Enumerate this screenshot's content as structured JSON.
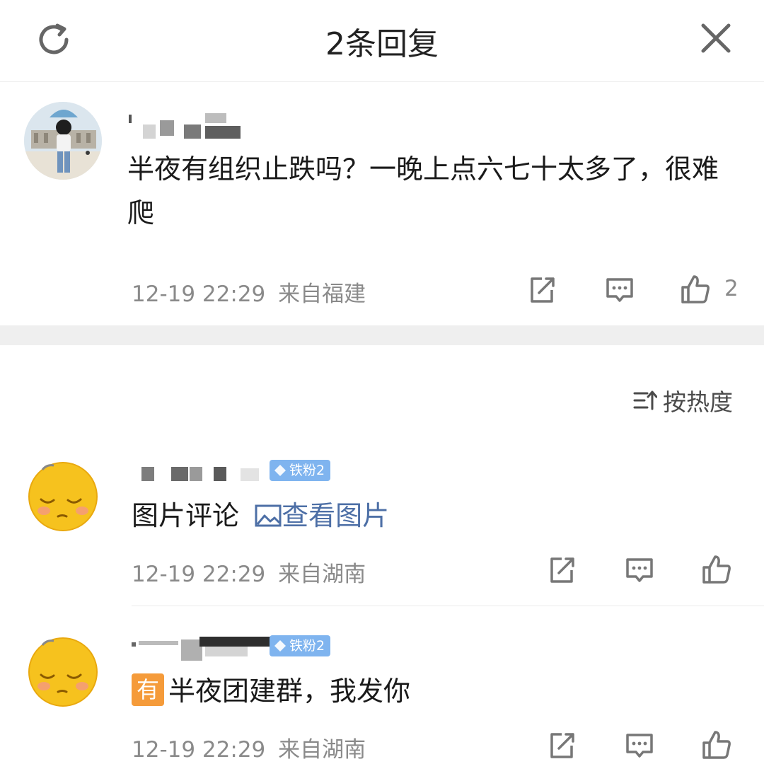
{
  "header": {
    "title": "2条回复"
  },
  "main_comment": {
    "text": "半夜有组织止跌吗？一晚上点六七十太多了，很难爬",
    "time": "12-19 22:29",
    "location": "来自福建",
    "like_count": "2"
  },
  "sort": {
    "label": "按热度"
  },
  "replies": [
    {
      "badge": "铁粉2",
      "text_prefix": "图片评论",
      "view_image_label": "查看图片",
      "time": "12-19 22:29",
      "location": "来自湖南"
    },
    {
      "badge": "铁粉2",
      "tag": "有",
      "text": "半夜团建群，我发你",
      "time": "12-19 22:29",
      "location": "来自湖南"
    }
  ],
  "colors": {
    "badge": "#7fb4ef",
    "link": "#4d6fa6",
    "tag": "#f59b3a",
    "meta": "#8a8a8a"
  },
  "icons": [
    "refresh-icon",
    "close-icon",
    "share-icon",
    "comment-icon",
    "like-icon",
    "sort-icon",
    "image-icon",
    "diamond-icon"
  ]
}
